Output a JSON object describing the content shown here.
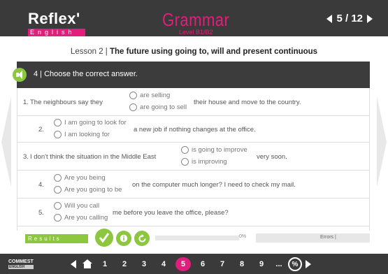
{
  "header": {
    "logo": "Reflex'",
    "logo_sub": "English",
    "title": "Grammar",
    "level": "Level B1/B2",
    "page": "5 / 12"
  },
  "lesson": {
    "prefix": "Lesson 2 | ",
    "title": "The future using going to, will and present continuous"
  },
  "exercise": {
    "title": "4 | Choose the correct answer.",
    "questions": [
      {
        "number": "1.",
        "before": "The neighbours say they",
        "options": [
          "are selling",
          "are going to sell"
        ],
        "after": "their house and move to the country."
      },
      {
        "number": "2.",
        "before": "",
        "options": [
          "I am going to look for",
          "I am looking for"
        ],
        "after": "a new job if nothing changes at the office."
      },
      {
        "number": "3.",
        "before": "I don't think the situation in the Middle East",
        "options": [
          "is going to improve",
          "is improving"
        ],
        "after": "very soon."
      },
      {
        "number": "4.",
        "before": "",
        "options": [
          "Are you being",
          "Are you going to be"
        ],
        "after": "on the computer much longer? I need to check my mail."
      },
      {
        "number": "5.",
        "before": "",
        "options": [
          "Will you call",
          "Are you calling"
        ],
        "after": "me before you leave the office, please?"
      }
    ]
  },
  "results": {
    "label": "Results",
    "percent": "0%",
    "errors_label": "Errors |"
  },
  "footer": {
    "logo_top": "COMMEST",
    "logo_bottom": "ENGLISH",
    "pages": [
      "1",
      "2",
      "3",
      "4",
      "5",
      "6",
      "7",
      "8",
      "9"
    ],
    "active_page": "5",
    "dots": "...",
    "pct_icon": "%"
  }
}
